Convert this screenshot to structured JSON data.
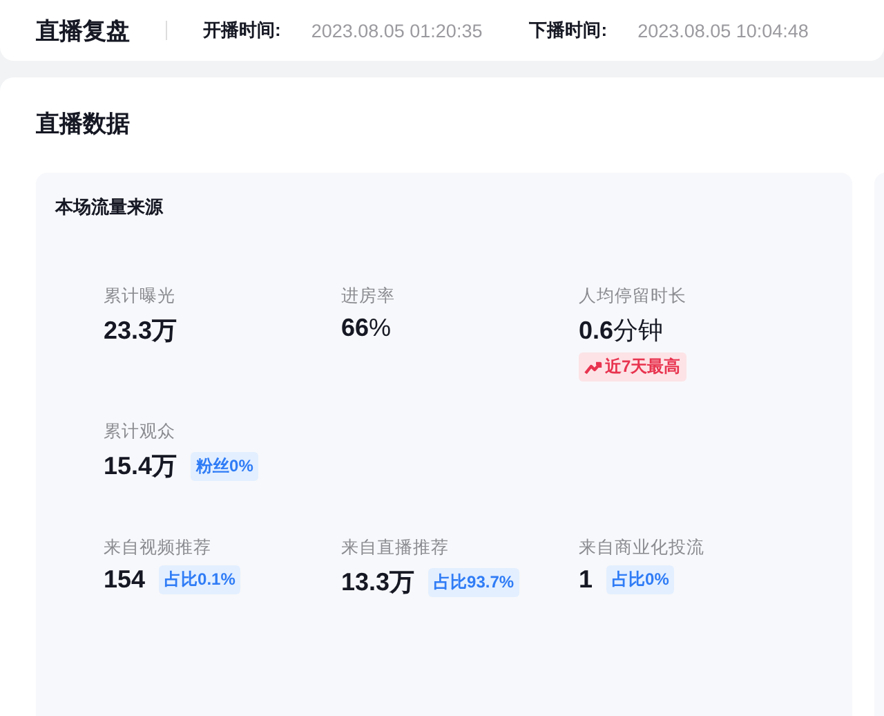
{
  "header": {
    "title": "直播复盘",
    "start_label": "开播时间:",
    "start_time": "2023.08.05 01:20:35",
    "end_label": "下播时间:",
    "end_time": "2023.08.05 10:04:48"
  },
  "section": {
    "title": "直播数据",
    "panel": {
      "title": "本场流量来源",
      "rows": [
        [
          {
            "label": "累计曝光",
            "value": "**23.3万**"
          },
          {
            "label": "进房率",
            "value": "**66**%"
          },
          {
            "label": "人均停留时长",
            "value": "**0.6**分钟",
            "badge": {
              "kind": "trend",
              "text": "近7天最高"
            }
          }
        ],
        [
          {
            "label": "累计观众",
            "value": "**15.4万**",
            "badge": {
              "kind": "share",
              "text": "粉丝0%"
            }
          }
        ],
        [
          {
            "label": "来自视频推荐",
            "value": "**154**",
            "badge": {
              "kind": "share",
              "text": "占比0.1%"
            }
          },
          {
            "label": "来自直播推荐",
            "value": "**13.3万**",
            "badge": {
              "kind": "share",
              "text": "占比93.7%"
            }
          },
          {
            "label": "来自商业化投流",
            "value": "**1**",
            "badge": {
              "kind": "share",
              "text": "占比0%"
            }
          }
        ]
      ]
    }
  }
}
